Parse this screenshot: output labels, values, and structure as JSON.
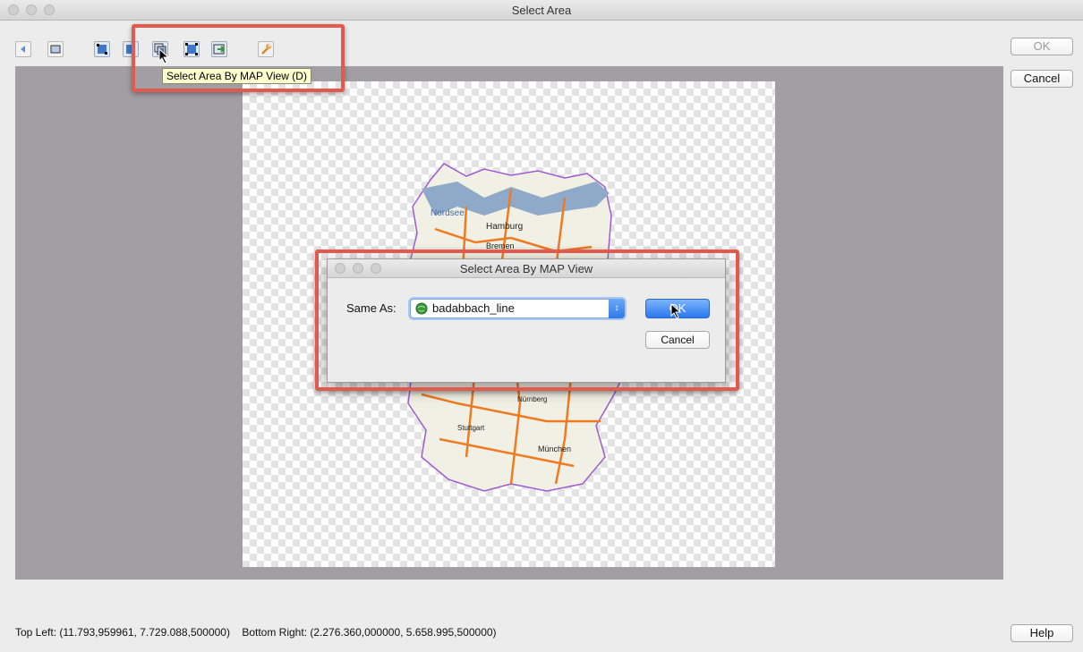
{
  "window": {
    "title": "Select Area"
  },
  "toolbar": {
    "tooltip": "Select Area By MAP View (D)",
    "icons": [
      "back-icon",
      "zoom-extent-icon",
      "select-area-icon",
      "select-layer-icon",
      "select-by-map-view-icon",
      "select-extent-icon",
      "export-icon",
      "settings-wrench-icon"
    ]
  },
  "side": {
    "ok_label": "OK",
    "cancel_label": "Cancel",
    "help_label": "Help"
  },
  "map": {
    "labels": [
      "Nordsee",
      "Hamburg",
      "Bremen",
      "Nürnberg",
      "Stuttgart",
      "München"
    ]
  },
  "dialog": {
    "title": "Select Area By MAP View",
    "same_as_label": "Same As:",
    "selected_layer": "badabbach_line",
    "ok_label": "OK",
    "cancel_label": "Cancel"
  },
  "status": {
    "top_left": "Top Left: (11.793,959961, 7.729.088,500000)",
    "bottom_right": "Bottom Right: (2.276.360,000000, 5.658.995,500000)"
  },
  "colors": {
    "highlight_box": "#e05a4f",
    "canvas_bg": "#a19fa3",
    "accent": "#2a78ee"
  }
}
